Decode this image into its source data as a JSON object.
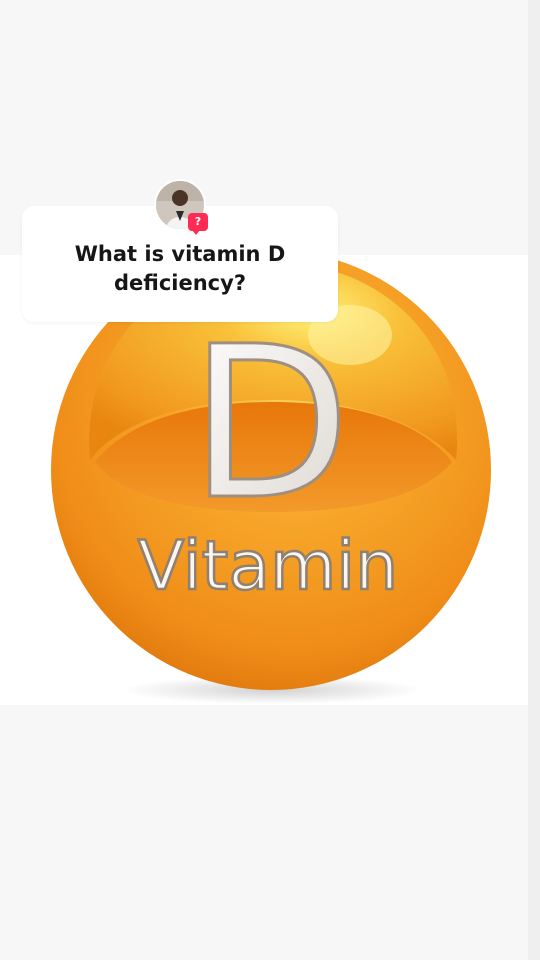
{
  "question": {
    "text": "What is vitamin D deficiency?",
    "badge_symbol": "?"
  },
  "image": {
    "letter": "D",
    "word": "Vitamin"
  },
  "colors": {
    "sphere_orange": "#f29a1e",
    "sphere_highlight": "#ffe65c",
    "badge_pink": "#fe2c55",
    "background": "#f7f7f7"
  }
}
